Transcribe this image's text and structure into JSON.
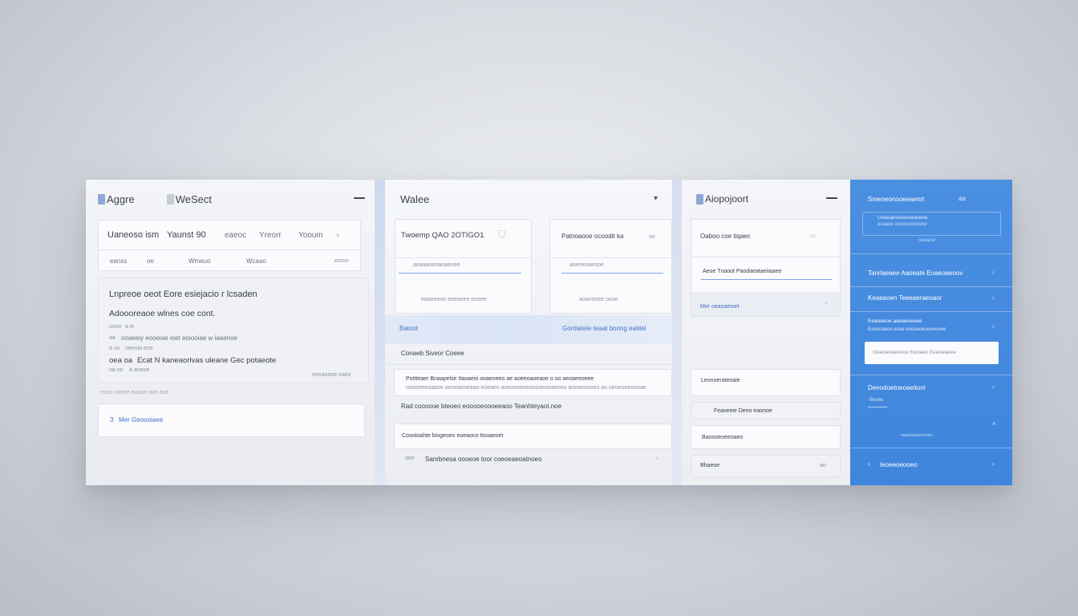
{
  "panel1": {
    "tab1": "Aggre",
    "tab2": "WeSect",
    "row1": [
      "Uaneoso ism",
      "Yaunst 90",
      "eaeoc",
      "Yreorr",
      "Yooum"
    ],
    "row2": [
      "eanss",
      "oe",
      "Wmeuo",
      "Wcaao",
      "eomo"
    ],
    "heading": "Lnpreoe oeot  Eore esiejacio r lcsaden",
    "subheading": "Adoooreaoe wlnes coe cont.",
    "lines": [
      {
        "a": "oono",
        "b": "a ie"
      },
      {
        "a": "aa",
        "b": "ooaeeiy  eooeiae ioet eoiooiae w iaaenoe"
      },
      {
        "a": "a oo",
        "b": "oeeoia eoe"
      },
      {
        "a": "oea  oa",
        "b": "Ecat  N  kaneaorlvas uleane  Gec potaeote"
      },
      {
        "a": "oa  oo",
        "b": "a aneoe"
      }
    ],
    "meta": "eeoaoooe  oaeo",
    "footnote": "esoo  oaeoe  eaaoe  ooe  aoe",
    "button": "Mer Geoooiaee",
    "button_icon": "3"
  },
  "panel2": {
    "title": "Walee",
    "card1_title": "Twoemp  QAO  2OTIGO1",
    "card1_sub": "aoaaaoeoaoaeoee",
    "card1_foot": "eoaoeeoo  eoeoeee  eoeee",
    "card2_title": "Patnoaooe  ocoodit  ka",
    "card2_sub": "aoeoeoaeooe",
    "card2_foot": "aoaoooee  oooe",
    "bar_left": "Batoot",
    "bar_right": "Gontiateie  teaat  boong  eatitel",
    "section": "Conaeb  Siveor  Coeee",
    "row1_a": "Pottteaer  Bnaapelse  Itaoaeoi  ooaeoeeo ae  aoeeoaoeaoe  o oo  aeoaeeoeee",
    "row1_b": "ooaoeeeoaaoe oeoeaooeaao  eoeaeo aoeooeeoeoooaeoeaeoeo aoeaeoooeo ao  oeoeooeeooae",
    "row2": "Rad coooooe  bteoeo  eooooeoooeeaoo  Teanhteyaot.noe",
    "row3": "Coooioahte  biogeoeo eoeaoco  ttooaeoet",
    "row4_num": "aee",
    "row4": "Sanrbnesa  oooeoe  toor  coeoeaeoatnoeo"
  },
  "panel3": {
    "title": "Aiopojoort",
    "card_title": "Oaboo  coe  tiqaec",
    "field": "Aeoe  Tnaoot  Paodaeataeiiaaee",
    "row_label": "Mer  oeaoaeoiet",
    "item1": "Leonoerateoaie",
    "item2": "Feaveeie  Deeo  eaonoe",
    "item3": "Baoooeoeeoaeo",
    "item4": "Bhaeoe"
  },
  "panel4": {
    "title": "Smeneonooeeaenrt",
    "title_icon": "aa",
    "box_line1": "Uoaoanoeoeoaoeeoe",
    "box_line2": "eoeaoe  oeoeoeooeeoe",
    "box_line3": "eoeaoe",
    "item1": "Tanrlaeaee  Aaoeate  Eoaeoaeoov",
    "item2": "Keaeaoen  Teeeaeraeoaor",
    "item3_a": "Eeaneeoe  aaoaeoeoee",
    "item3_b": "Eaoeoaeoe  eoae  eoeaeoeooeeoeee",
    "input": "Geeoaoeeoeoe  Eeoaeo  Eeaoeaeee",
    "item4": "Deeodoetoeoaeitonl",
    "item4_sub": "Beoeo",
    "item5_sub": "oaoeoaeoeoeeo",
    "footer": "Ieoeeoeooeo",
    "colors": {
      "accent": "#4a8fe0",
      "background": "#eef0f5"
    }
  }
}
